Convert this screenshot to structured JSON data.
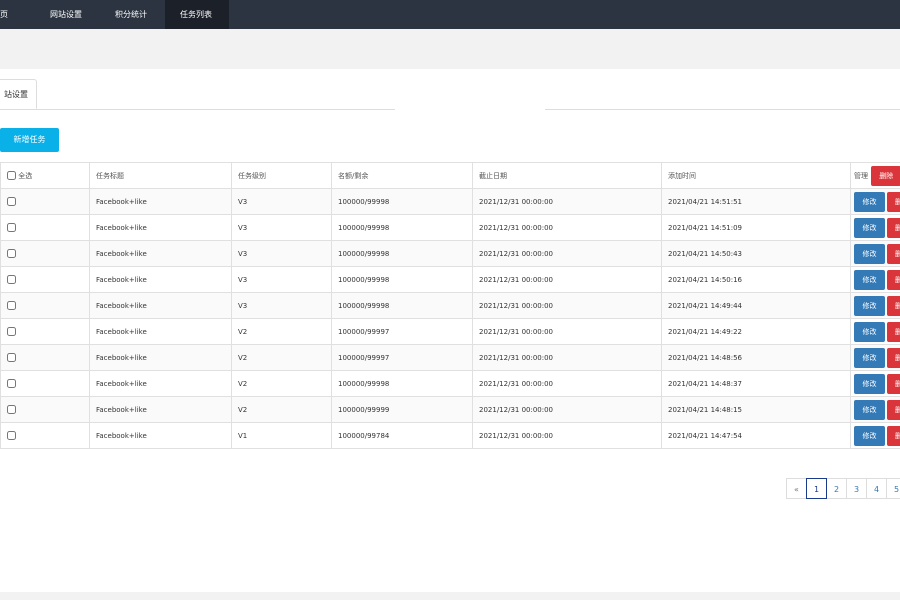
{
  "nav": {
    "items": [
      {
        "label": "页",
        "active": false
      },
      {
        "label": "网站设置",
        "active": false
      },
      {
        "label": "积分统计",
        "active": false
      },
      {
        "label": "任务列表",
        "active": true
      }
    ]
  },
  "tabs": [
    {
      "label": "站设置"
    }
  ],
  "toolbar": {
    "add_label": "新增任务"
  },
  "table": {
    "headers": {
      "select_all": "全选",
      "title": "任务标题",
      "level": "任务级别",
      "quota": "名额/剩余",
      "deadline": "截止日期",
      "added": "添加时间",
      "manage": "管理",
      "delete_all": "删除"
    },
    "rows": [
      {
        "title": "Facebook+like",
        "level": "V3",
        "quota": "100000/99998",
        "deadline": "2021/12/31 00:00:00",
        "added": "2021/04/21 14:51:51"
      },
      {
        "title": "Facebook+like",
        "level": "V3",
        "quota": "100000/99998",
        "deadline": "2021/12/31 00:00:00",
        "added": "2021/04/21 14:51:09"
      },
      {
        "title": "Facebook+like",
        "level": "V3",
        "quota": "100000/99998",
        "deadline": "2021/12/31 00:00:00",
        "added": "2021/04/21 14:50:43"
      },
      {
        "title": "Facebook+like",
        "level": "V3",
        "quota": "100000/99998",
        "deadline": "2021/12/31 00:00:00",
        "added": "2021/04/21 14:50:16"
      },
      {
        "title": "Facebook+like",
        "level": "V3",
        "quota": "100000/99998",
        "deadline": "2021/12/31 00:00:00",
        "added": "2021/04/21 14:49:44"
      },
      {
        "title": "Facebook+like",
        "level": "V2",
        "quota": "100000/99997",
        "deadline": "2021/12/31 00:00:00",
        "added": "2021/04/21 14:49:22"
      },
      {
        "title": "Facebook+like",
        "level": "V2",
        "quota": "100000/99997",
        "deadline": "2021/12/31 00:00:00",
        "added": "2021/04/21 14:48:56"
      },
      {
        "title": "Facebook+like",
        "level": "V2",
        "quota": "100000/99998",
        "deadline": "2021/12/31 00:00:00",
        "added": "2021/04/21 14:48:37"
      },
      {
        "title": "Facebook+like",
        "level": "V2",
        "quota": "100000/99999",
        "deadline": "2021/12/31 00:00:00",
        "added": "2021/04/21 14:48:15"
      },
      {
        "title": "Facebook+like",
        "level": "V1",
        "quota": "100000/99784",
        "deadline": "2021/12/31 00:00:00",
        "added": "2021/04/21 14:47:54"
      }
    ],
    "row_actions": {
      "edit": "修改",
      "delete": "删除"
    }
  },
  "pagination": {
    "prev": "«",
    "pages": [
      "1",
      "2",
      "3",
      "4",
      "5"
    ],
    "current": "1"
  },
  "colors": {
    "nav_bg": "#2b3440",
    "nav_active_bg": "#1b2029",
    "add_button": "#0ab0e8",
    "edit_button": "#337ab7",
    "delete_button": "#d9353a"
  }
}
